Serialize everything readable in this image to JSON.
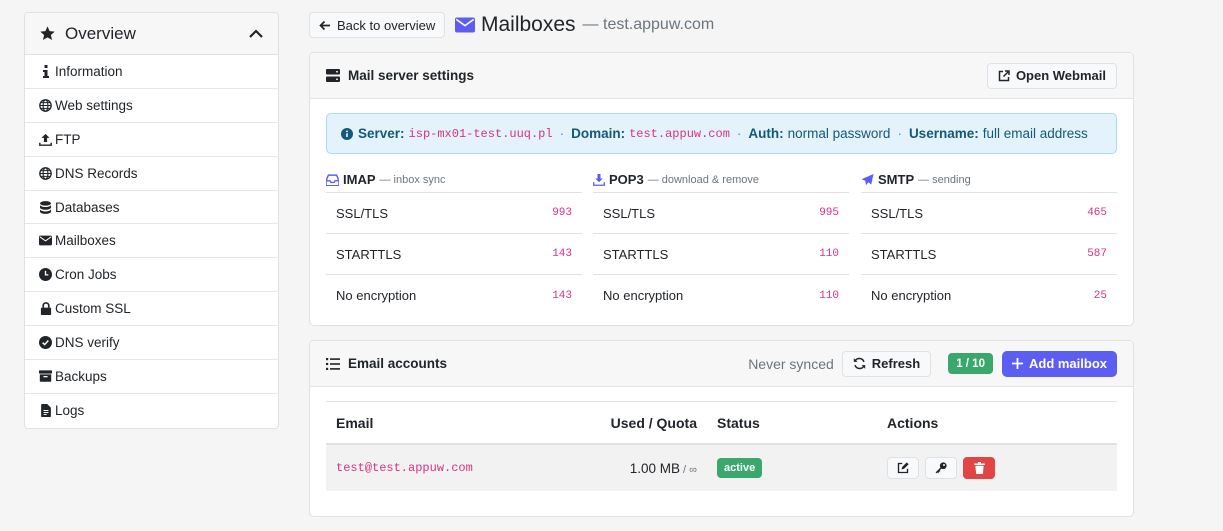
{
  "sidebar": {
    "title": "Overview",
    "items": [
      {
        "label": "Information",
        "icon": "info-icon"
      },
      {
        "label": "Web settings",
        "icon": "globe-icon"
      },
      {
        "label": "FTP",
        "icon": "upload-icon"
      },
      {
        "label": "DNS Records",
        "icon": "globe-icon"
      },
      {
        "label": "Databases",
        "icon": "database-icon"
      },
      {
        "label": "Mailboxes",
        "icon": "envelope-icon"
      },
      {
        "label": "Cron Jobs",
        "icon": "clock-icon"
      },
      {
        "label": "Custom SSL",
        "icon": "lock-icon"
      },
      {
        "label": "DNS verify",
        "icon": "check-circle-icon"
      },
      {
        "label": "Backups",
        "icon": "archive-icon"
      },
      {
        "label": "Logs",
        "icon": "file-icon"
      }
    ]
  },
  "header": {
    "back_label": "Back to overview",
    "title": "Mailboxes",
    "subtitle": "— test.appuw.com"
  },
  "mail_settings": {
    "title": "Mail server settings",
    "webmail_label": "Open Webmail",
    "info": {
      "server_label": "Server:",
      "server_value": "isp-mx01-test.uuq.pl",
      "domain_label": "Domain:",
      "domain_value": "test.appuw.com",
      "auth_label": "Auth:",
      "auth_value": "normal password",
      "username_label": "Username:",
      "username_value": "full email address",
      "separator": "·"
    },
    "protocols": [
      {
        "name": "IMAP",
        "desc": "— inbox sync",
        "icon": "inbox-icon",
        "rows": [
          {
            "label": "SSL/TLS",
            "port": "993"
          },
          {
            "label": "STARTTLS",
            "port": "143"
          },
          {
            "label": "No encryption",
            "port": "143"
          }
        ]
      },
      {
        "name": "POP3",
        "desc": "— download & remove",
        "icon": "download-icon",
        "rows": [
          {
            "label": "SSL/TLS",
            "port": "995"
          },
          {
            "label": "STARTTLS",
            "port": "110"
          },
          {
            "label": "No encryption",
            "port": "110"
          }
        ]
      },
      {
        "name": "SMTP",
        "desc": "— sending",
        "icon": "paper-plane-icon",
        "rows": [
          {
            "label": "SSL/TLS",
            "port": "465"
          },
          {
            "label": "STARTTLS",
            "port": "587"
          },
          {
            "label": "No encryption",
            "port": "25"
          }
        ]
      }
    ]
  },
  "accounts": {
    "title": "Email accounts",
    "sync_status": "Never synced",
    "refresh_label": "Refresh",
    "count": "1 / 10",
    "add_label": "Add mailbox",
    "columns": {
      "email": "Email",
      "used": "Used / Quota",
      "status": "Status",
      "actions": "Actions"
    },
    "rows": [
      {
        "email": "test@test.appuw.com",
        "used": "1.00 MB",
        "quota": "/ ∞",
        "status": "active"
      }
    ]
  },
  "colors": {
    "accent": "#5b5ef0",
    "success": "#3aa76d",
    "danger": "#e14646",
    "code": "#d63384"
  }
}
